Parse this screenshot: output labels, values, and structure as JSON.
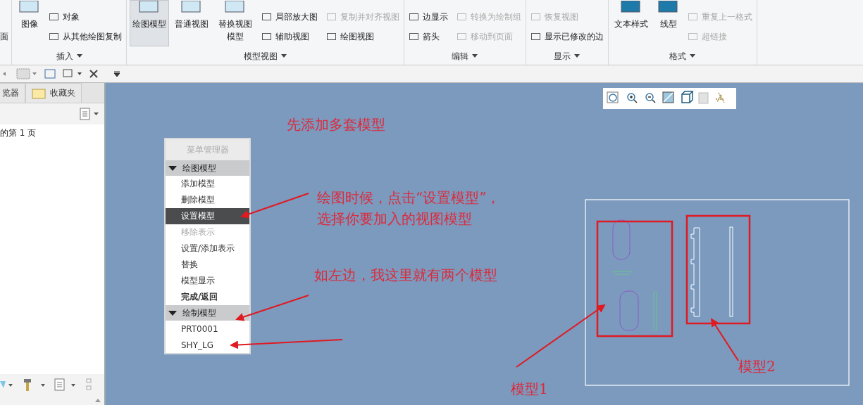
{
  "ribbon": {
    "groups": [
      {
        "items": [
          {
            "kind": "small",
            "label": "面",
            "disabled": false
          }
        ]
      },
      {
        "label": "插入",
        "items": [
          {
            "kind": "large",
            "label": "图像",
            "selected": false,
            "disabled": false
          },
          {
            "kind": "small",
            "label": "对象",
            "disabled": false
          },
          {
            "kind": "small",
            "label": "从其他绘图复制",
            "disabled": false
          }
        ]
      },
      {
        "label": "模型视图",
        "items": [
          {
            "kind": "large",
            "label": "绘图模型",
            "selected": true,
            "disabled": false
          },
          {
            "kind": "large",
            "label": "普通视图",
            "selected": false,
            "disabled": false
          },
          {
            "kind": "large",
            "label": "替换视图模型",
            "selected": false,
            "disabled": false
          },
          {
            "kind": "small",
            "label": "局部放大图",
            "disabled": false
          },
          {
            "kind": "small",
            "label": "辅助视图",
            "disabled": false
          },
          {
            "kind": "small",
            "label": "复制并对齐视图",
            "disabled": true
          },
          {
            "kind": "small",
            "label": "绘图视图",
            "disabled": false
          }
        ]
      },
      {
        "label": "编辑",
        "items": [
          {
            "kind": "small",
            "label": "边显示",
            "disabled": false
          },
          {
            "kind": "small",
            "label": "箭头",
            "disabled": false
          },
          {
            "kind": "small",
            "label": "转换为绘制组",
            "disabled": true
          },
          {
            "kind": "small",
            "label": "移动到页面",
            "disabled": true
          }
        ]
      },
      {
        "label": "显示",
        "items": [
          {
            "kind": "small",
            "label": "恢复视图",
            "disabled": true
          },
          {
            "kind": "small",
            "label": "显示已修改的边",
            "disabled": false
          }
        ]
      },
      {
        "label": "格式",
        "items": [
          {
            "kind": "large",
            "label": "文本样式",
            "selected": false,
            "disabled": false
          },
          {
            "kind": "large",
            "label": "线型",
            "selected": false,
            "disabled": false
          },
          {
            "kind": "small",
            "label": "重复上一格式",
            "disabled": true
          },
          {
            "kind": "small",
            "label": "超链接",
            "disabled": true
          }
        ]
      }
    ]
  },
  "left_panel": {
    "tabs": [
      {
        "label": "览器",
        "selected": false
      },
      {
        "label": "收藏夹",
        "selected": false
      }
    ],
    "tree_text": "的第 1 页"
  },
  "menu_manager": {
    "title": "菜单管理器",
    "sections": [
      {
        "title": "绘图模型",
        "expanded": true,
        "items": [
          {
            "label": "添加模型",
            "kind": "option",
            "selected": false,
            "disabled": false
          },
          {
            "label": "删除模型",
            "kind": "option",
            "selected": false,
            "disabled": false
          },
          {
            "label": "设置模型",
            "kind": "option",
            "selected": true,
            "disabled": false
          },
          {
            "label": "移除表示",
            "kind": "option",
            "selected": false,
            "disabled": true
          },
          {
            "label": "设置/添加表示",
            "kind": "option",
            "selected": false,
            "disabled": false
          },
          {
            "label": "替换",
            "kind": "option",
            "selected": false,
            "disabled": false
          },
          {
            "label": "模型显示",
            "kind": "option",
            "selected": false,
            "disabled": false
          },
          {
            "label": "完成/返回",
            "kind": "done",
            "selected": false,
            "disabled": false
          }
        ]
      },
      {
        "title": "绘制模型",
        "expanded": true,
        "items": [
          {
            "label": "PRT0001",
            "kind": "option",
            "selected": false,
            "disabled": false
          },
          {
            "label": "SHY_LG",
            "kind": "option",
            "selected": false,
            "disabled": false
          }
        ]
      }
    ]
  },
  "annotations": [
    {
      "lines": [
        "先添加多套模型"
      ]
    },
    {
      "lines": [
        "绘图时候，点击“设置模型”，",
        "选择你要加入的视图模型"
      ]
    },
    {
      "lines": [
        "如左边，我这里就有两个模型"
      ]
    },
    {
      "lines": [
        "模型1"
      ]
    },
    {
      "lines": [
        "模型2"
      ]
    }
  ]
}
